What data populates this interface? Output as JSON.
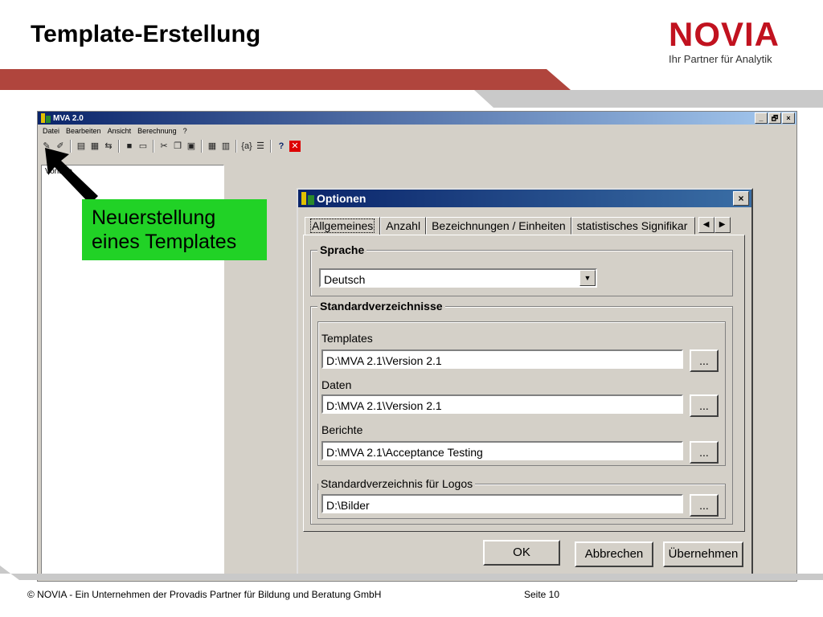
{
  "slide": {
    "title": "Template-Erstellung"
  },
  "logo": {
    "word": "NOVIA",
    "tagline": "Ihr Partner für Analytik"
  },
  "app": {
    "title": "MVA 2.0",
    "window_buttons": [
      "_",
      "🗗",
      "×"
    ],
    "menu": [
      "Datei",
      "Bearbeiten",
      "Ansicht",
      "Berechnung",
      "?"
    ],
    "tree_item": "Vorlage"
  },
  "callout": {
    "line1": "Neuerstellung",
    "line2": "eines Templates",
    "color": "#21d226"
  },
  "dialog": {
    "title": "Optionen",
    "close": "×",
    "tabs": [
      "Allgemeines",
      "Anzahl",
      "Bezeichnungen / Einheiten",
      "statistisches Signifikar"
    ],
    "sprache": {
      "label": "Sprache",
      "value": "Deutsch"
    },
    "standardverzeichnisse": {
      "label": "Standardverzeichnisse",
      "templates_label": "Templates",
      "templates_value": "D:\\MVA 2.1\\Version 2.1",
      "daten_label": "Daten",
      "daten_value": "D:\\MVA 2.1\\Version 2.1",
      "berichte_label": "Berichte",
      "berichte_value": "D:\\MVA 2.1\\Acceptance Testing"
    },
    "logos": {
      "label": "Standardverzeichnis für Logos",
      "value": "D:\\Bilder"
    },
    "browse": "...",
    "buttons": {
      "ok": "OK",
      "cancel": "Abbrechen",
      "apply": "Übernehmen"
    }
  },
  "footer": {
    "text": "©  NOVIA  - Ein Unternehmen der Provadis Partner für Bildung und Beratung GmbH",
    "page": "Seite 10"
  },
  "colors": {
    "accent_red": "#c1121f",
    "title_blue": "#0a246a",
    "window_gray": "#d4d0c8"
  }
}
